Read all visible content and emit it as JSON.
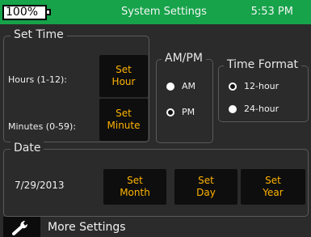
{
  "header": {
    "battery": "100%",
    "title": "System Settings",
    "time": "5:53 PM",
    "accent_color": "#16a34a"
  },
  "set_time": {
    "legend": "Set Time",
    "hours_label": "Hours (1-12):",
    "hour_button": "Set\nHour",
    "minutes_label": "Minutes (0-59):",
    "minute_button": "Set\nMinute"
  },
  "ampm": {
    "legend": "AM/PM",
    "options": [
      {
        "label": "AM",
        "selected": false
      },
      {
        "label": "PM",
        "selected": true
      }
    ]
  },
  "time_format": {
    "legend": "Time Format",
    "options": [
      {
        "label": "12-hour",
        "selected": true
      },
      {
        "label": "24-hour",
        "selected": false
      }
    ]
  },
  "date": {
    "legend": "Date",
    "value": "7/29/2013",
    "buttons": {
      "month": "Set\nMonth",
      "day": "Set\nDay",
      "year": "Set\nYear"
    },
    "button_text_color": "#ffb300"
  },
  "footer": {
    "more_label": "More Settings",
    "icon": "wrench-icon"
  }
}
